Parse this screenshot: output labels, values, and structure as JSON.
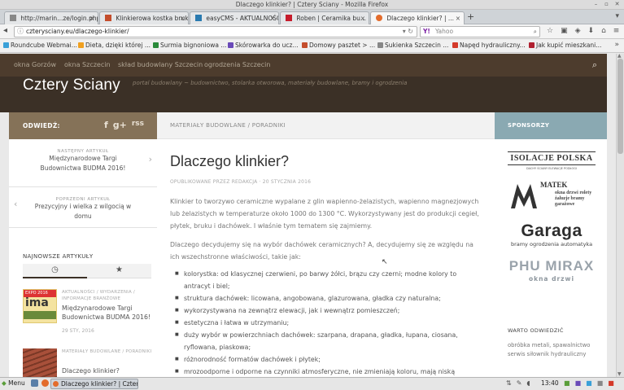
{
  "window": {
    "title": "Dlaczego klinkier? | Cztery Sciany - Mozilla Firefox"
  },
  "tabs": [
    {
      "label": "http://marin...ze/login.php",
      "color": "#888888"
    },
    {
      "label": "Klinkierowa kostka bruk...",
      "color": "#c44d2c"
    },
    {
      "label": "easyCMS - AKTUALNOŚCI",
      "color": "#2a7ab0"
    },
    {
      "label": "Roben | Ceramika bu...",
      "color": "#c61c2c"
    },
    {
      "label": "Dlaczego klinkier? | ...",
      "color": "#e36c2c"
    }
  ],
  "url": "czterysciany.eu/dlaczego-klinkier/",
  "search": {
    "placeholder": "Yahoo"
  },
  "bookmarks": [
    {
      "label": "Roundcube Webmai...",
      "color": "#3aa0d8"
    },
    {
      "label": "Dieta, dzięki której ...",
      "color": "#f0a020"
    },
    {
      "label": "Surmia bignoniowa ...",
      "color": "#2a8a3a"
    },
    {
      "label": "Skórowarka do ucz...",
      "color": "#6a4ab8"
    },
    {
      "label": "Domowy pasztet > ...",
      "color": "#c44d2c"
    },
    {
      "label": "Sukienka Szczecin ...",
      "color": "#888888"
    },
    {
      "label": "Napęd hydrauliczny...",
      "color": "#d43a2a"
    },
    {
      "label": "Jak kupić mieszkani...",
      "color": "#b02030"
    }
  ],
  "site": {
    "nav": [
      "okna Gorzów",
      "okna Szczecin",
      "skład budowlany Szczecin",
      "ogrodzenia Szczecin"
    ],
    "title": "Cztery Sciany",
    "description": "portal budowlany ~ budownictwo, stolarka otworowa, materiały budowlane, bramy i ogrodzenia"
  },
  "left_sidebar": {
    "follow": "ODWIEDŹ:",
    "social": [
      "f",
      "g+",
      "rss"
    ],
    "next": {
      "label": "NASTĘPNY ARTYKUŁ",
      "title": "Międzynarodowe Targi Budownictwa BUDMA 2016!"
    },
    "prev": {
      "label": "POPRZEDNI ARTYKUŁ",
      "title": "Prezycyjny i wielka z wilgocią w domu"
    },
    "latest_label": "NAJNOWSZE ARTYKUŁY",
    "articles": [
      {
        "category": "AKTUALNOŚCI / WYDARZENIA / INFORMACJE BRANŻOWE",
        "title": "Międzynarodowe Targi Budownictwa BUDMA 2016!",
        "date": "29 STY, 2016"
      },
      {
        "category": "MATERIAŁY BUDOWLANE / PORADNIKI",
        "title": "Dlaczego klinkier?",
        "date": ""
      }
    ]
  },
  "main": {
    "breadcrumb": "MATERIAŁY BUDOWLANE / PORADNIKI",
    "title": "Dlaczego klinkier?",
    "meta": "OPUBLIKOWANE PRZEZ REDAKCJA · 20 STYCZNIA 2016",
    "para1": "Klinkier to tworzywo ceramiczne wypalane z glin wapienno-żelazistych, wapienno magnezjowych lub żelazistych w temperaturze około 1000 do 1300 °C. Wykorzystywany jest do produkcji cegieł, płytek, bruku i dachówek. I właśnie tym tematem się zajmiemy.",
    "para2": "Dlaczego decydujemy się na wybór dachówek ceramicznych? A, decydujemy się ze względu na ich wszechstronne właściwości, takie jak:",
    "bullets": [
      "kolorystka: od klasycznej czerwieni, po barwy żółci, brązu czy czerni; modne kolory to antracyt i biel;",
      "struktura dachówek: licowana, angobowana, glazurowana, gładka czy naturalna;",
      "wykorzystywana na zewnątrz elewacji, jak i wewnątrz pomieszczeń;",
      "estetyczna i łatwa w utrzymaniu;",
      "duży wybór w powierzchniach dachówek: szarpana, drapana, gładka, łupana, ciosana, ryflowana, piaskowa;",
      "różnorodność formatów dachówek i płytek;",
      "mrozoodporne i odporne na czynniki atmosferyczne, nie zmieniają koloru, mają niską"
    ]
  },
  "right_sidebar": {
    "sponsors": "SPONSORZY",
    "logos": [
      {
        "name": "ISOLACJE POLSKA",
        "sub": "DACHY ŚCIANY ELEWACJE PODŁOGI"
      },
      {
        "name": "MATEK",
        "sub": "okna drzwi rolety żaluzje bramy garażowe"
      },
      {
        "name": "Garaga",
        "sub": "bramy ogrodzenia automatyka"
      },
      {
        "name": "PHU MIRAX",
        "sub": "okna drzwi"
      }
    ],
    "visit_label": "WARTO ODWIEDZIĆ",
    "visit_text": "obróbka metali, spawalnictwo serwis siłownik hydrauliczny"
  },
  "taskbar": {
    "menu": "Menu",
    "task": "Dlaczego klinkier? | Cztery...",
    "clock": "13:40"
  },
  "colors": {
    "nav": "#4d3c2d",
    "header": "#3b3026",
    "sidebar_head": "#857258",
    "sponsors_head": "#8aa9b2"
  }
}
